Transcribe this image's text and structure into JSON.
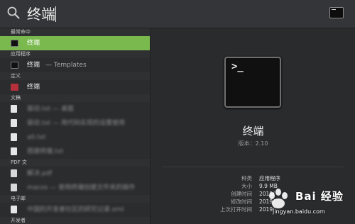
{
  "search": {
    "query": "终端"
  },
  "sections": {
    "top_hit": "最常命中",
    "applications": "应用程序",
    "definition": "定义",
    "documents": "文稿",
    "pdf": "PDF 文",
    "email": "电子邮",
    "developer": "开发者"
  },
  "results": {
    "top_hit_item": "终端",
    "app_item": "终端",
    "app_item_suffix": "— Templates",
    "definition_item": "终端",
    "doc_1": "驱动.txt — 桌面",
    "doc_2": "驱动.txt — 用代码实现的设置使用",
    "doc_3": "a0.txt",
    "doc_4": "搭建终端.txt",
    "pdf_1": "解决.pdf",
    "pdf_2": "macos — 使用终端创建文件夹的操作",
    "email_1": "中国的开发者社区的研究记录.eml"
  },
  "preview": {
    "title": "终端",
    "version": "版本：2.10",
    "meta": [
      {
        "label": "种类",
        "value": "应用程序"
      },
      {
        "label": "大小",
        "value": "9.9 MB"
      },
      {
        "label": "创建时间",
        "value": "2019/"
      },
      {
        "label": "修改时间",
        "value": "2019/"
      },
      {
        "label": "上次打开时间",
        "value": "2019/"
      }
    ]
  },
  "watermark": {
    "brand": "Bai 经验",
    "url": "jingyan.baidu.com"
  },
  "icons": {
    "search": "search-icon",
    "terminal": "terminal-icon",
    "dictionary": "dictionary-icon",
    "document": "document-icon",
    "pdf": "pdf-icon"
  },
  "colors": {
    "selection": "#79b94d",
    "background": "#2d2e30"
  }
}
